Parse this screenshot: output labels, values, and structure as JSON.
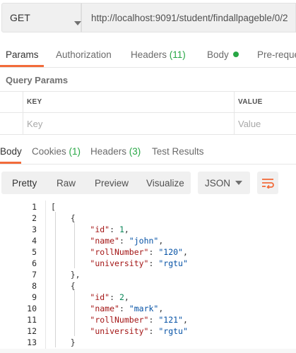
{
  "request": {
    "method": "GET",
    "url": "http://localhost:9091/student/findallpageble/0/2"
  },
  "request_tabs": [
    {
      "label": "Params"
    },
    {
      "label": "Authorization"
    },
    {
      "label": "Headers",
      "count": "(11)"
    },
    {
      "label": "Body"
    },
    {
      "label": "Pre-reque"
    }
  ],
  "query_params": {
    "title": "Query Params",
    "key_header": "KEY",
    "value_header": "VALUE",
    "key_placeholder": "Key",
    "value_placeholder": "Value"
  },
  "response_tabs": [
    {
      "label": "Body"
    },
    {
      "label": "Cookies",
      "count": "(1)"
    },
    {
      "label": "Headers",
      "count": "(3)"
    },
    {
      "label": "Test Results"
    }
  ],
  "response_toolbar": {
    "modes": [
      "Pretty",
      "Raw",
      "Preview",
      "Visualize"
    ],
    "format": "JSON"
  },
  "code_lines": [
    {
      "n": "1",
      "text": "["
    },
    {
      "n": "2",
      "text": "    {"
    },
    {
      "n": "3",
      "key": "\"id\"",
      "sep": ": ",
      "num": "1",
      "end": ","
    },
    {
      "n": "4",
      "key": "\"name\"",
      "sep": ": ",
      "str": "\"john\"",
      "end": ","
    },
    {
      "n": "5",
      "key": "\"rollNumber\"",
      "sep": ": ",
      "str": "\"120\"",
      "end": ","
    },
    {
      "n": "6",
      "key": "\"university\"",
      "sep": ": ",
      "str": "\"rgtu\"",
      "end": ""
    },
    {
      "n": "7",
      "text": "    },"
    },
    {
      "n": "8",
      "text": "    {"
    },
    {
      "n": "9",
      "key": "\"id\"",
      "sep": ": ",
      "num": "2",
      "end": ","
    },
    {
      "n": "10",
      "key": "\"name\"",
      "sep": ": ",
      "str": "\"mark\"",
      "end": ","
    },
    {
      "n": "11",
      "key": "\"rollNumber\"",
      "sep": ": ",
      "str": "\"121\"",
      "end": ","
    },
    {
      "n": "12",
      "key": "\"university\"",
      "sep": ": ",
      "str": "\"rgtu\"",
      "end": ""
    },
    {
      "n": "13",
      "text": "    }"
    }
  ],
  "colors": {
    "accent": "#f26b3a",
    "green": "#28a745",
    "json_key": "#a31515",
    "json_string": "#0451a5",
    "json_number": "#098658"
  },
  "icons": {
    "method_dropdown": "chevron-down-icon",
    "body_indicator": "dot-icon",
    "format_dropdown": "chevron-down-icon",
    "wrap": "wrap-lines-icon"
  }
}
